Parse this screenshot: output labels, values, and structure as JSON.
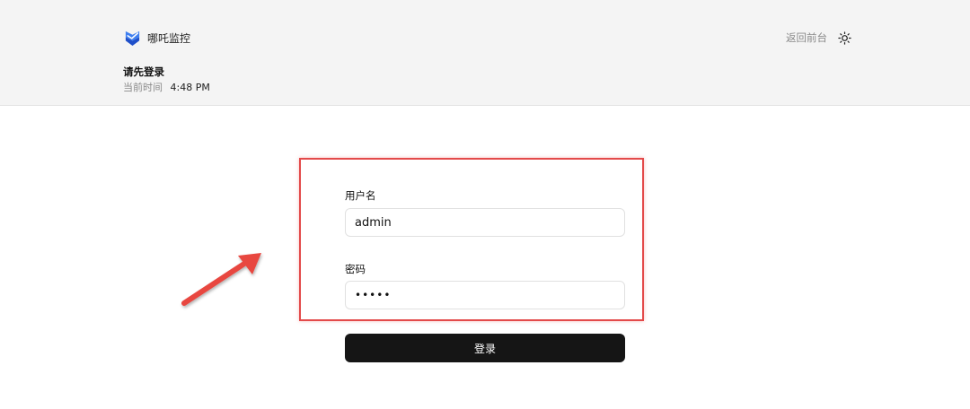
{
  "brand": {
    "name": "哪吒监控",
    "logo_icon": "check-shield-icon",
    "logo_color": "#1f5ae0"
  },
  "header": {
    "back_link": "返回前台",
    "theme_icon": "sun-icon",
    "page_title": "请先登录",
    "time_label": "当前时间",
    "time_value": "4:48 PM"
  },
  "form": {
    "username_label": "用户名",
    "username_value": "admin",
    "password_label": "密码",
    "password_value": "•••••",
    "submit_label": "登录"
  },
  "annotation": {
    "highlight_color": "#e34a4a",
    "arrow_icon": "red-arrow-icon"
  }
}
